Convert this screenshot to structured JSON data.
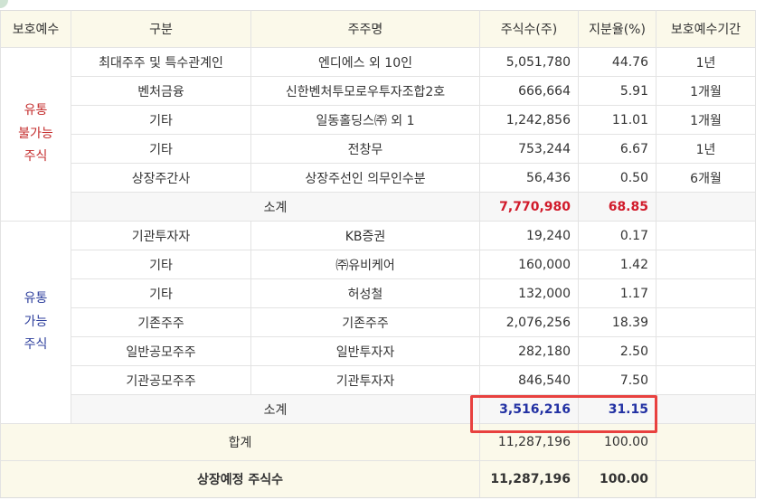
{
  "table": {
    "headers": {
      "period_col_left": "보호예수",
      "category": "구분",
      "holder": "주주명",
      "shares": "주식수(주)",
      "ratio": "지분율(%)",
      "lockup_period": "보호예수기간"
    },
    "restricted": {
      "group_label_lines": [
        "유통",
        "불가능",
        "주식"
      ],
      "rows": [
        {
          "category": "최대주주 및 특수관계인",
          "holder": "엔디에스 외 10인",
          "shares": "5,051,780",
          "ratio": "44.76",
          "period": "1년"
        },
        {
          "category": "벤처금융",
          "holder": "신한벤처투모로우투자조합2호",
          "shares": "666,664",
          "ratio": "5.91",
          "period": "1개월"
        },
        {
          "category": "기타",
          "holder": "일동홀딩스㈜ 외 1",
          "shares": "1,242,856",
          "ratio": "11.01",
          "period": "1개월"
        },
        {
          "category": "기타",
          "holder": "전창무",
          "shares": "753,244",
          "ratio": "6.67",
          "period": "1년"
        },
        {
          "category": "상장주간사",
          "holder": "상장주선인 의무인수분",
          "shares": "56,436",
          "ratio": "0.50",
          "period": "6개월"
        }
      ],
      "subtotal": {
        "label": "소계",
        "shares": "7,770,980",
        "ratio": "68.85"
      }
    },
    "tradable": {
      "group_label_lines": [
        "유통",
        "가능",
        "주식"
      ],
      "rows": [
        {
          "category": "기관투자자",
          "holder": "KB증권",
          "shares": "19,240",
          "ratio": "0.17",
          "period": ""
        },
        {
          "category": "기타",
          "holder": "㈜유비케어",
          "shares": "160,000",
          "ratio": "1.42",
          "period": ""
        },
        {
          "category": "기타",
          "holder": "허성철",
          "shares": "132,000",
          "ratio": "1.17",
          "period": ""
        },
        {
          "category": "기존주주",
          "holder": "기존주주",
          "shares": "2,076,256",
          "ratio": "18.39",
          "period": ""
        },
        {
          "category": "일반공모주주",
          "holder": "일반투자자",
          "shares": "282,180",
          "ratio": "2.50",
          "period": ""
        },
        {
          "category": "기관공모주주",
          "holder": "기관투자자",
          "shares": "846,540",
          "ratio": "7.50",
          "period": ""
        }
      ],
      "subtotal": {
        "label": "소계",
        "shares": "3,516,216",
        "ratio": "31.15"
      }
    },
    "total": {
      "label": "합계",
      "shares": "11,287,196",
      "ratio": "100.00"
    },
    "listing": {
      "label": "상장예정 주식수",
      "shares": "11,287,196",
      "ratio": "100.00"
    }
  },
  "colors": {
    "header_bg": "#fbf9ea",
    "restricted_label": "#c42c2c",
    "tradable_label": "#2c3e9c",
    "subtotal_red": "#d11a2a",
    "subtotal_blue": "#2231a3",
    "highlight_border": "#e8413f"
  }
}
